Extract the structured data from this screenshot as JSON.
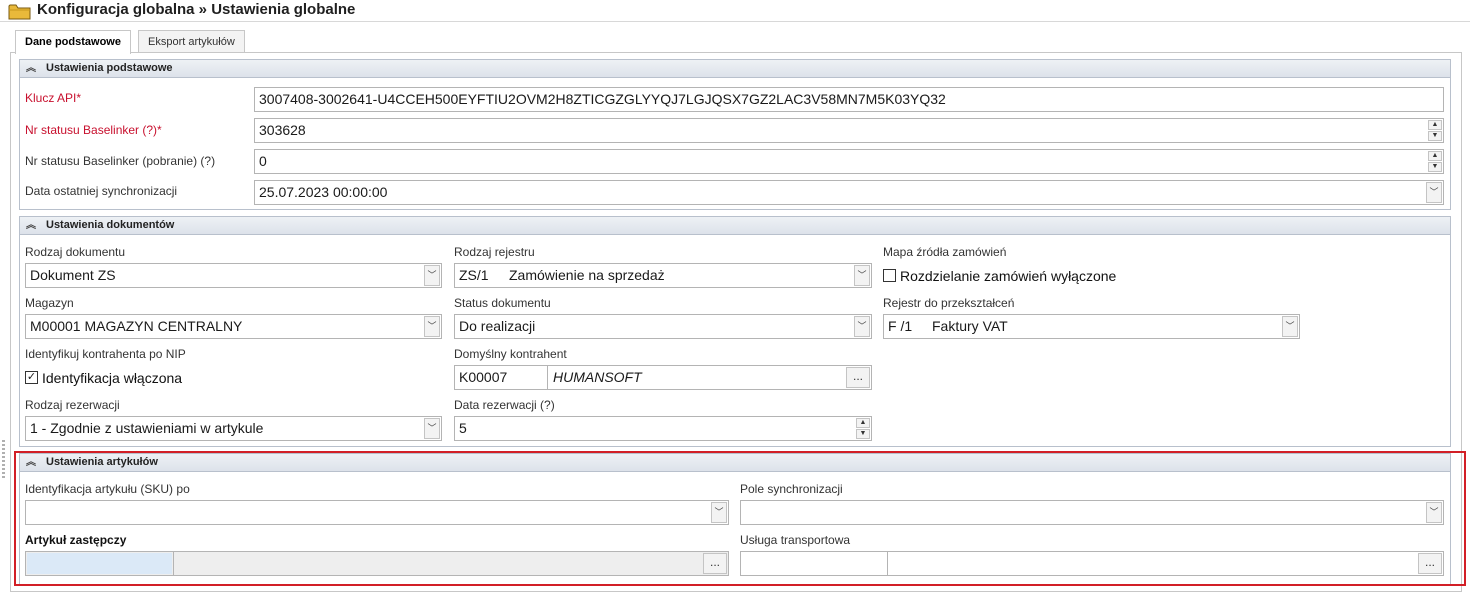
{
  "window": {
    "title": "Konfiguracja globalna » Ustawienia globalne",
    "icon": "folder-icon"
  },
  "tabs": [
    {
      "label": "Dane podstawowe",
      "active": true
    },
    {
      "label": "Eksport artykułów",
      "active": false
    }
  ],
  "basic": {
    "header": "Ustawienia podstawowe",
    "api_key": {
      "label": "Klucz API*",
      "value": "3007408-3002641-U4CCEH500EYFTIU2OVM2H8ZTICGZGLYYQJ7LGJQSX7GZ2LAC3V58MN7M5K03YQ32"
    },
    "status_nr": {
      "label": "Nr statusu Baselinker (?)*",
      "value": "303628"
    },
    "status_nr_download": {
      "label": "Nr statusu Baselinker (pobranie) (?)",
      "value": "0"
    },
    "last_sync": {
      "label": "Data ostatniej synchronizacji",
      "value": "25.07.2023 00:00:00"
    }
  },
  "documents": {
    "header": "Ustawienia dokumentów",
    "doc_type": {
      "label": "Rodzaj dokumentu",
      "value": "Dokument ZS"
    },
    "register_type": {
      "label": "Rodzaj rejestru",
      "code": "ZS/1",
      "value": "Zamówienie na sprzedaż"
    },
    "order_source_map": {
      "label": "Mapa źródła zamówień",
      "checkbox_label": "Rozdzielanie zamówień wyłączone",
      "checked": false
    },
    "warehouse": {
      "label": "Magazyn",
      "value": "M00001  MAGAZYN CENTRALNY"
    },
    "doc_status": {
      "label": "Status dokumentu",
      "value": "Do realizacji"
    },
    "conversion_register": {
      "label": "Rejestr do przekształceń",
      "code": "F /1",
      "value": "Faktury VAT"
    },
    "identify_by_nip": {
      "label": "Identyfikuj kontrahenta po NIP",
      "checkbox_label": "Identyfikacja włączona",
      "checked": true
    },
    "default_contractor": {
      "label": "Domyślny kontrahent",
      "code": "K00007",
      "name": "HUMANSOFT"
    },
    "reservation_type": {
      "label": "Rodzaj rezerwacji",
      "value": "1 - Zgodnie z ustawieniami w artykule"
    },
    "reservation_date": {
      "label": "Data rezerwacji (?)",
      "value": "5"
    }
  },
  "articles": {
    "header": "Ustawienia artykułów",
    "sku_identification": {
      "label": "Identyfikacja artykułu (SKU) po",
      "value": ""
    },
    "sync_field": {
      "label": "Pole synchronizacji",
      "value": ""
    },
    "substitute_article": {
      "label": "Artykuł zastępczy",
      "value": ""
    },
    "transport_service": {
      "label": "Usługa transportowa",
      "code": "",
      "value": ""
    }
  },
  "ui": {
    "ellipsis": "...",
    "dropdown_arrow": "﹀",
    "spin_up": "▲",
    "spin_down": "▼",
    "collapse_chevron": "︽",
    "check_mark": "✓",
    "highlight_color": "#d21f26"
  }
}
